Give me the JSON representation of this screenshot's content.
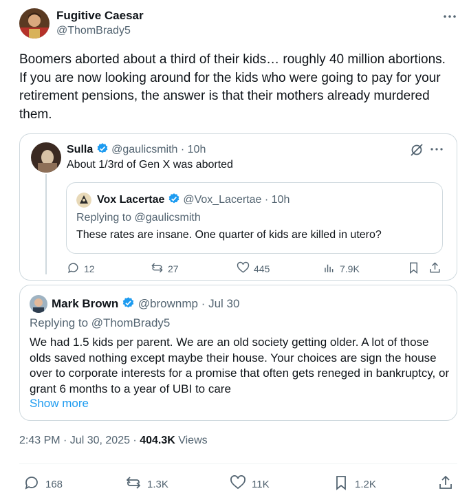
{
  "tweet": {
    "author_name": "Fugitive Caesar",
    "author_handle": "@ThomBrady5",
    "text": "Boomers aborted about a third of their kids… roughly 40 million abortions. If you are now looking around for the kids who were going to pay for your retirement pensions, the answer is that their mothers already murdered them.",
    "time": "2:43 PM · Jul 30, 2025 · ",
    "views_count": "404.3K",
    "views_label": " Views",
    "actions": {
      "replies": "168",
      "reposts": "1.3K",
      "likes": "11K",
      "bookmarks": "1.2K"
    }
  },
  "quote": {
    "author_name": "Sulla",
    "author_handle": "@gaulicsmith",
    "time": "· 10h",
    "text": "About 1/3rd of Gen X was aborted",
    "nested": {
      "author_name": "Vox Lacertae",
      "author_handle": "@Vox_Lacertae",
      "time": "· 10h",
      "reply_prefix": "Replying to ",
      "reply_handle": "@gaulicsmith",
      "text": "These rates are insane. One quarter of kids are killed in utero?"
    },
    "actions": {
      "replies": "12",
      "reposts": "27",
      "likes": "445",
      "views": "7.9K"
    }
  },
  "reply_card": {
    "author_name": "Mark Brown",
    "author_handle": "@brownmp",
    "time": "· Jul 30",
    "reply_prefix": "Replying to ",
    "reply_handle": "@ThomBrady5",
    "text": "We had 1.5 kids per parent. We are an old society getting older. A lot of those olds saved nothing except maybe their house. Your choices are sign the house over to corporate interests for a promise that often gets reneged in bankruptcy, or grant 6 months to a year of UBI to care",
    "show_more": "Show more"
  },
  "colors": {
    "accent": "#1d9bf0",
    "muted": "#536471",
    "border": "#cfd9de"
  }
}
